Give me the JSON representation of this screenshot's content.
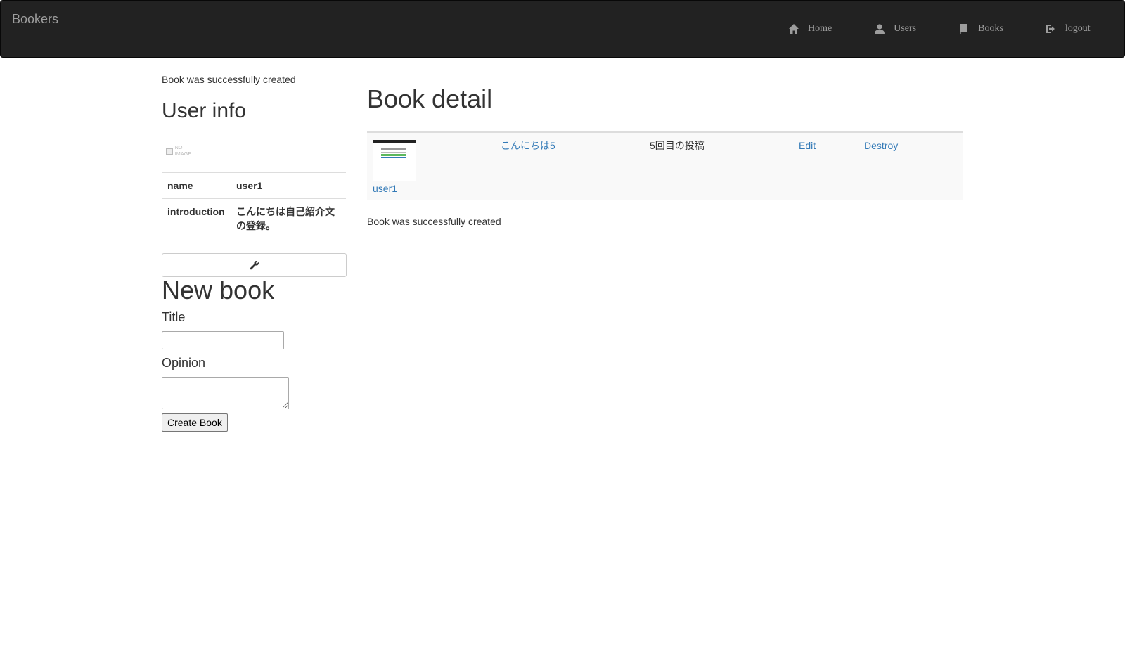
{
  "navbar": {
    "brand": "Bookers",
    "items": [
      {
        "label": "Home",
        "icon": "home-icon"
      },
      {
        "label": "Users",
        "icon": "user-icon"
      },
      {
        "label": "Books",
        "icon": "book-icon"
      },
      {
        "label": "logout",
        "icon": "logout-icon"
      }
    ]
  },
  "sidebar": {
    "flash": "Book was successfully created",
    "user_info_heading": "User info",
    "avatar_alt": "NO IMAGE",
    "profile": {
      "name_label": "name",
      "name_value": "user1",
      "introduction_label": "introduction",
      "introduction_value": "こんにちは自己紹介文の登録。"
    },
    "edit_icon": "wrench-icon",
    "new_book": {
      "heading": "New book",
      "title_label": "Title",
      "title_value": "",
      "opinion_label": "Opinion",
      "opinion_value": "",
      "submit_label": "Create Book"
    }
  },
  "main": {
    "heading": "Book detail",
    "book": {
      "user": "user1",
      "title": "こんにちは5",
      "opinion": "5回目の投稿",
      "edit_label": "Edit",
      "destroy_label": "Destroy"
    },
    "flash": "Book was successfully created"
  },
  "colors": {
    "navbar_bg": "#222222",
    "nav_text": "#9d9d9d",
    "link": "#337ab7",
    "text": "#333333",
    "row_bg": "#f9f9f9"
  }
}
